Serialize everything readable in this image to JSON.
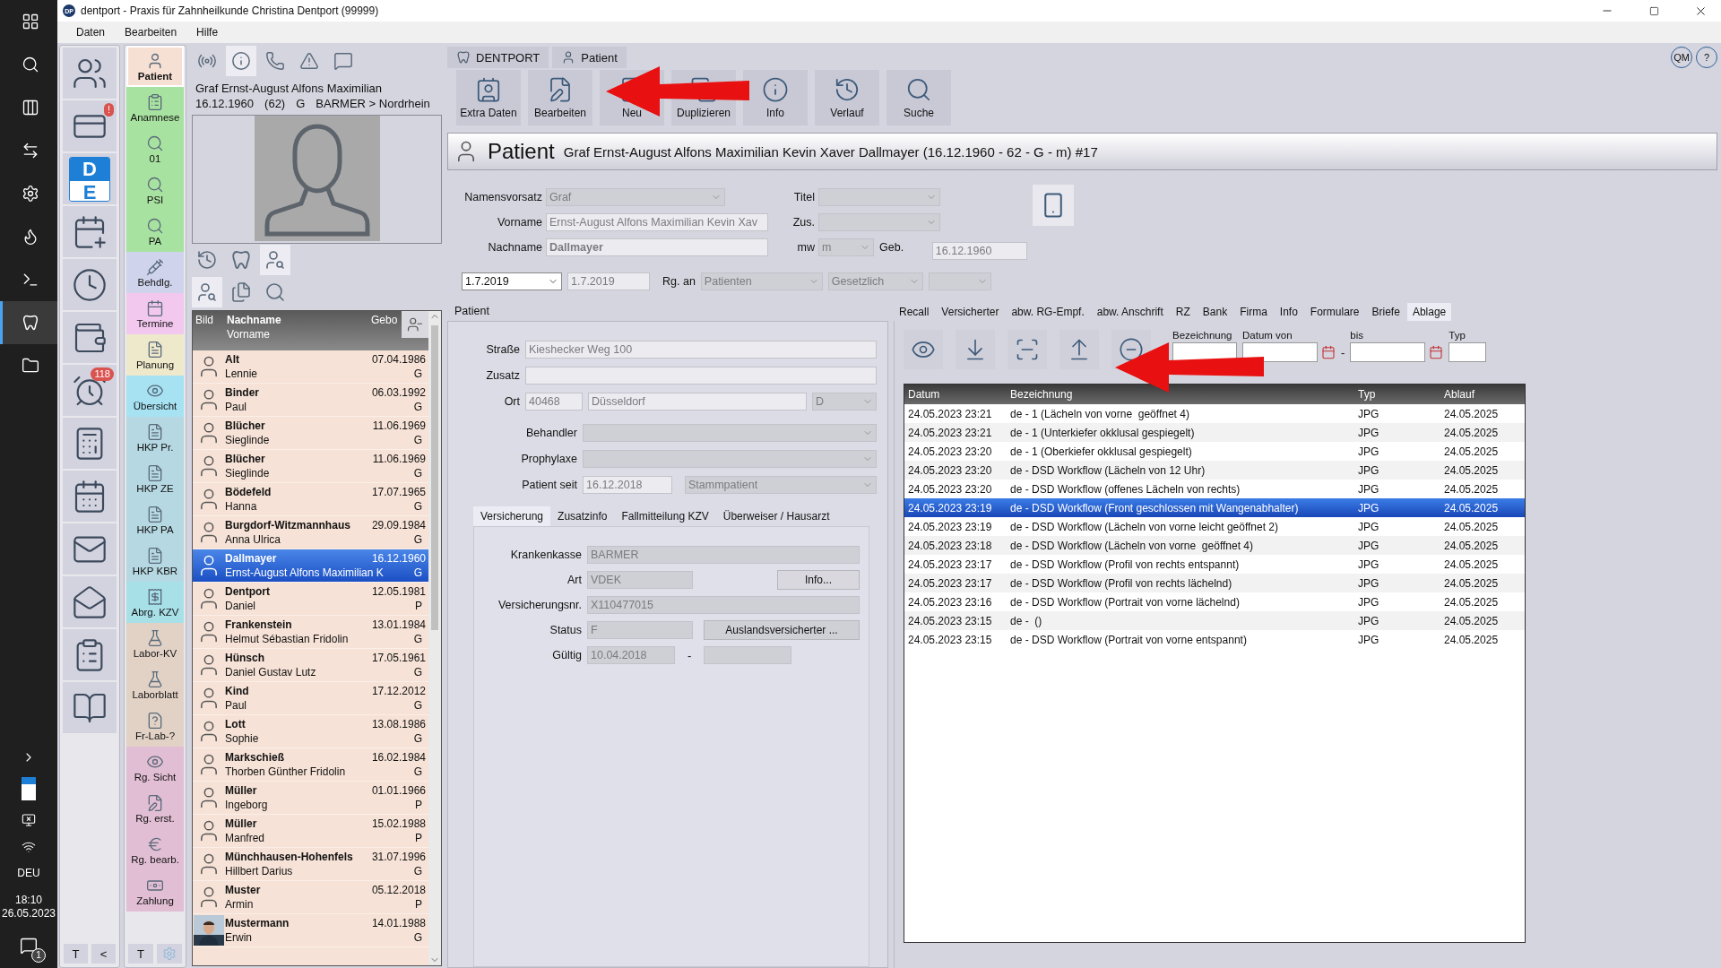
{
  "window": {
    "title": "dentport - Praxis für Zahnheilkunde Christina Dentport (99999)",
    "logo": "DP"
  },
  "menu": [
    "Daten",
    "Bearbeiten",
    "Hilfe"
  ],
  "taskbar": {
    "apps": [
      {
        "kind": "windows",
        "selected": false
      },
      {
        "kind": "search",
        "selected": false
      },
      {
        "kind": "taskview",
        "selected": false
      },
      {
        "kind": "remote",
        "selected": false
      },
      {
        "kind": "settings",
        "selected": false
      },
      {
        "kind": "browser",
        "selected": false
      },
      {
        "kind": "terminal",
        "selected": false
      },
      {
        "kind": "tooth",
        "selected": true
      },
      {
        "kind": "folder",
        "selected": false
      }
    ],
    "language": "DEU",
    "time": "18:10",
    "date": "26.05.2023",
    "notifications": "1"
  },
  "quick_bar": {
    "items": [
      {
        "kind": "patients"
      },
      {
        "kind": "card",
        "badge": "!"
      },
      {
        "kind": "de",
        "letters": [
          "D",
          "E"
        ]
      },
      {
        "kind": "appointment-add"
      },
      {
        "kind": "clock-person"
      },
      {
        "kind": "person-money"
      },
      {
        "kind": "alarm",
        "badge": "118"
      },
      {
        "kind": "calculator"
      },
      {
        "kind": "calendar-money"
      },
      {
        "kind": "mail"
      },
      {
        "kind": "person-mail"
      },
      {
        "kind": "clipboard"
      },
      {
        "kind": "book"
      }
    ],
    "buttons": [
      "T",
      "<"
    ]
  },
  "modules": {
    "items": [
      {
        "label": "Patient",
        "kind": "person",
        "color": "#f6e0d4",
        "selected": true
      },
      {
        "label": "Anamnese",
        "kind": "clipboard",
        "color": "#a8e2a0",
        "selected": false
      },
      {
        "label": "01",
        "kind": "search",
        "color": "#a8e2a0",
        "selected": false
      },
      {
        "label": "PSI",
        "kind": "search",
        "color": "#a8e2a0",
        "selected": false
      },
      {
        "label": "PA",
        "kind": "search",
        "color": "#a8e2a0",
        "selected": false
      },
      {
        "label": "Behdlg.",
        "kind": "brush",
        "color": "#cfd4ec",
        "selected": false
      },
      {
        "label": "Termine",
        "kind": "calendar",
        "color": "#f2c8ee",
        "selected": false
      },
      {
        "label": "Planung",
        "kind": "planning",
        "color": "#efe9cc",
        "selected": false
      },
      {
        "label": "Übersicht",
        "kind": "eye",
        "color": "#a6e2f2",
        "selected": false
      },
      {
        "label": "HKP Pr.",
        "kind": "document",
        "color": "#b6d8e2",
        "selected": false
      },
      {
        "label": "HKP ZE",
        "kind": "document",
        "color": "#b6d8e2",
        "selected": false
      },
      {
        "label": "HKP PA",
        "kind": "document",
        "color": "#b6d8e2",
        "selected": false
      },
      {
        "label": "HKP KBR",
        "kind": "document",
        "color": "#b6d8e2",
        "selected": false
      },
      {
        "label": "Abrg. KZV",
        "kind": "invoice",
        "color": "#a8e0e8",
        "selected": false
      },
      {
        "label": "Labor-KV",
        "kind": "flask",
        "color": "#e2d2c6",
        "selected": false
      },
      {
        "label": "Laborblatt",
        "kind": "flask",
        "color": "#e2d2c6",
        "selected": false
      },
      {
        "label": "Fr-Lab-?",
        "kind": "question",
        "color": "#e2d2c6",
        "selected": false
      },
      {
        "label": "Rg. Sicht",
        "kind": "eye",
        "color": "#e2bed4",
        "selected": false
      },
      {
        "label": "Rg. erst.",
        "kind": "pen",
        "color": "#e2bed4",
        "selected": false
      },
      {
        "label": "Rg. bearb.",
        "kind": "euro",
        "color": "#e2bed4",
        "selected": false
      },
      {
        "label": "Zahlung",
        "kind": "money",
        "color": "#e2bed4",
        "selected": false
      }
    ],
    "buttons": [
      "T"
    ]
  },
  "patient_panel": {
    "tabs": [
      {
        "kind": "broadcast",
        "selected": false
      },
      {
        "kind": "info",
        "selected": true
      },
      {
        "kind": "phone",
        "selected": false
      },
      {
        "kind": "warning",
        "selected": false
      },
      {
        "kind": "chat",
        "selected": false
      }
    ],
    "name": "Graf Ernst-August Alfons Maximilian",
    "birth_date": "16.12.1960",
    "age": "(62)",
    "status": "G",
    "insurance": "BARMER > Nordrhein",
    "tools": [
      {
        "kind": "history",
        "selected": false
      },
      {
        "kind": "tooth",
        "selected": false
      },
      {
        "kind": "search-person",
        "selected": true
      }
    ],
    "list_tools": [
      {
        "kind": "search-person",
        "selected": true
      },
      {
        "kind": "documents",
        "selected": false
      },
      {
        "kind": "search",
        "selected": false
      }
    ]
  },
  "patient_list": {
    "columns": {
      "picture": "Bild",
      "last_name": "Nachname",
      "first_name": "Vorname",
      "birth": "Gebo"
    },
    "rows": [
      {
        "last": "Alt",
        "first": "Lennie",
        "dob": "07.04.1986",
        "status": "G",
        "selected": false
      },
      {
        "last": "Binder",
        "first": "Paul",
        "dob": "06.03.1992",
        "status": "G",
        "selected": false
      },
      {
        "last": "Blücher",
        "first": "Sieglinde",
        "dob": "11.06.1969",
        "status": "G",
        "selected": false
      },
      {
        "last": "Blücher",
        "first": "Sieglinde",
        "dob": "11.06.1969",
        "status": "G",
        "selected": false
      },
      {
        "last": "Bödefeld",
        "first": "Hanna",
        "dob": "17.07.1965",
        "status": "G",
        "selected": false
      },
      {
        "last": "Burgdorf-Witzmannhaus",
        "first": "Anna Ulrica",
        "dob": "29.09.1984",
        "status": "G",
        "selected": false
      },
      {
        "last": "Dallmayer",
        "first": "Ernst-August Alfons Maximilian K",
        "dob": "16.12.1960",
        "status": "G",
        "selected": true
      },
      {
        "last": "Dentport",
        "first": "Daniel",
        "dob": "12.05.1981",
        "status": "P",
        "selected": false
      },
      {
        "last": "Frankenstein",
        "first": "Helmut Sébastian Fridolin",
        "dob": "13.01.1984",
        "status": "G",
        "selected": false
      },
      {
        "last": "Hünsch",
        "first": "Daniel Gustav Lutz",
        "dob": "17.05.1961",
        "status": "G",
        "selected": false
      },
      {
        "last": "Kind",
        "first": "Paul",
        "dob": "17.12.2012",
        "status": "G",
        "selected": false
      },
      {
        "last": "Lott",
        "first": "Sophie",
        "dob": "13.08.1986",
        "status": "G",
        "selected": false
      },
      {
        "last": "Markschieß",
        "first": "Thorben Günther Fridolin",
        "dob": "16.02.1984",
        "status": "G",
        "selected": false
      },
      {
        "last": "Müller",
        "first": "Ingeborg",
        "dob": "01.01.1966",
        "status": "P",
        "selected": false
      },
      {
        "last": "Müller",
        "first": "Manfred",
        "dob": "15.02.1988",
        "status": "P",
        "selected": false
      },
      {
        "last": "Münchhausen-Hohenfels",
        "first": "Hillbert Darius",
        "dob": "31.07.1996",
        "status": "G",
        "selected": false
      },
      {
        "last": "Muster",
        "first": "Armin",
        "dob": "05.12.2018",
        "status": "P",
        "selected": false
      },
      {
        "last": "Mustermann",
        "first": "Erwin",
        "dob": "14.01.1988",
        "status": "G",
        "selected": false,
        "kind": "picture"
      }
    ]
  },
  "breadcrumb": [
    {
      "label": "DENTPORT",
      "kind": "tooth"
    },
    {
      "label": "Patient",
      "kind": "person"
    }
  ],
  "help_buttons": [
    "QM",
    "?"
  ],
  "toolbar": [
    {
      "label": "Extra Daten",
      "kind": "extra"
    },
    {
      "label": "Bearbeiten",
      "kind": "edit"
    },
    {
      "label": "Neu",
      "kind": "new"
    },
    {
      "label": "Duplizieren",
      "kind": "duplicate"
    },
    {
      "label": "Info",
      "kind": "info"
    },
    {
      "label": "Verlauf",
      "kind": "history"
    },
    {
      "label": "Suche",
      "kind": "search"
    }
  ],
  "header": {
    "title": "Patient",
    "subtitle": "Graf Ernst-August Alfons Maximilian Kevin Xaver Dallmayer (16.12.1960 - 62 - G - m) #17"
  },
  "form": {
    "prefix": {
      "label": "Namensvorsatz",
      "value": "Graf"
    },
    "title": {
      "label": "Titel"
    },
    "first_name": {
      "label": "Vorname",
      "value": "Ernst-August Alfons Maximilian Kevin Xav"
    },
    "suffix": {
      "label": "Zus."
    },
    "last_name": {
      "label": "Nachname",
      "value": "Dallmayer"
    },
    "gender": {
      "label": "mw",
      "value": "m"
    },
    "birth": {
      "label": "Geb.",
      "value": "16.12.1960"
    }
  },
  "billing": {
    "period": "1.7.2019",
    "date": "1.7.2019",
    "label": "Rg. an",
    "recipient": "Patienten",
    "type": "Gesetzlich"
  },
  "section_label": "Patient",
  "tabs": [
    {
      "label": "Recall",
      "selected": false
    },
    {
      "label": "Versicherter",
      "selected": false
    },
    {
      "label": "abw. RG-Empf.",
      "selected": false
    },
    {
      "label": "abw. Anschrift",
      "selected": false
    },
    {
      "label": "RZ",
      "selected": false
    },
    {
      "label": "Bank",
      "selected": false
    },
    {
      "label": "Firma",
      "selected": false
    },
    {
      "label": "Info",
      "selected": false
    },
    {
      "label": "Formulare",
      "selected": false
    },
    {
      "label": "Briefe",
      "selected": false
    },
    {
      "label": "Ablage",
      "selected": true
    }
  ],
  "address": {
    "street": {
      "label": "Straße",
      "value": "Kieshecker Weg 100"
    },
    "extra": {
      "label": "Zusatz"
    },
    "city": {
      "label": "Ort",
      "zip": "40468",
      "city": "Düsseldorf",
      "country": "D"
    },
    "dentist": {
      "label": "Behandler"
    },
    "prophylaxis": {
      "label": "Prophylaxe"
    },
    "since": {
      "label": "Patient seit",
      "value": "16.12.2018",
      "type": "Stammpatient"
    }
  },
  "sub_tabs": [
    {
      "label": "Versicherung",
      "selected": true
    },
    {
      "label": "Zusatzinfo",
      "selected": false
    },
    {
      "label": "Fallmitteilung KZV",
      "selected": false
    },
    {
      "label": "Überweiser / Hausarzt",
      "selected": false
    }
  ],
  "insurance": {
    "fund": {
      "label": "Krankenkasse",
      "value": "BARMER"
    },
    "kind": {
      "label": "Art",
      "value": "VDEK",
      "button": "Info..."
    },
    "number": {
      "label": "Versicherungsnr.",
      "value": "X110477015"
    },
    "status": {
      "label": "Status",
      "value": "F",
      "button": "Auslandsversicherter ..."
    },
    "valid": {
      "label": "Gültig",
      "from": "10.04.2018",
      "separator": "-"
    }
  },
  "archive": {
    "tools": [
      {
        "kind": "view"
      },
      {
        "kind": "import"
      },
      {
        "kind": "scan"
      },
      {
        "kind": "export"
      },
      {
        "kind": "remove"
      }
    ],
    "filters": {
      "name": "Bezeichnung",
      "from": "Datum von",
      "separator": "-",
      "to": "bis",
      "type": "Typ"
    },
    "columns": [
      "Datum",
      "Bezeichnung",
      "Typ",
      "Ablauf"
    ],
    "rows": [
      {
        "date": "24.05.2023 23:21",
        "name": "de - 1 (Lächeln von vorne  geöffnet 4)",
        "type": "JPG",
        "expires": "24.05.2025",
        "selected": false
      },
      {
        "date": "24.05.2023 23:21",
        "name": "de - 1 (Unterkiefer okklusal gespiegelt)",
        "type": "JPG",
        "expires": "24.05.2025",
        "selected": false
      },
      {
        "date": "24.05.2023 23:20",
        "name": "de - 1 (Oberkiefer okklusal gespiegelt)",
        "type": "JPG",
        "expires": "24.05.2025",
        "selected": false
      },
      {
        "date": "24.05.2023 23:20",
        "name": "de - DSD Workflow (Lächeln von 12 Uhr)",
        "type": "JPG",
        "expires": "24.05.2025",
        "selected": false
      },
      {
        "date": "24.05.2023 23:20",
        "name": "de - DSD Workflow (offenes Lächeln von rechts)",
        "type": "JPG",
        "expires": "24.05.2025",
        "selected": false
      },
      {
        "date": "24.05.2023 23:19",
        "name": "de - DSD Workflow (Front geschlossen mit Wangenabhalter)",
        "type": "JPG",
        "expires": "24.05.2025",
        "selected": true
      },
      {
        "date": "24.05.2023 23:19",
        "name": "de - DSD Workflow (Lächeln von vorne leicht geöffnet 2)",
        "type": "JPG",
        "expires": "24.05.2025",
        "selected": false
      },
      {
        "date": "24.05.2023 23:18",
        "name": "de - DSD Workflow (Lächeln von vorne  geöffnet 4)",
        "type": "JPG",
        "expires": "24.05.2025",
        "selected": false
      },
      {
        "date": "24.05.2023 23:17",
        "name": "de - DSD Workflow (Profil von rechts entspannt)",
        "type": "JPG",
        "expires": "24.05.2025",
        "selected": false
      },
      {
        "date": "24.05.2023 23:17",
        "name": "de - DSD Workflow (Profil von rechts lächelnd)",
        "type": "JPG",
        "expires": "24.05.2025",
        "selected": false
      },
      {
        "date": "24.05.2023 23:16",
        "name": "de - DSD Workflow (Portrait von vorne lächelnd)",
        "type": "JPG",
        "expires": "24.05.2025",
        "selected": false
      },
      {
        "date": "24.05.2023 23:15",
        "name": "de -  ()",
        "type": "JPG",
        "expires": "24.05.2025",
        "selected": false
      },
      {
        "date": "24.05.2023 23:15",
        "name": "de - DSD Workflow (Portrait von vorne entspannt)",
        "type": "JPG",
        "expires": "24.05.2025",
        "selected": false
      }
    ]
  }
}
